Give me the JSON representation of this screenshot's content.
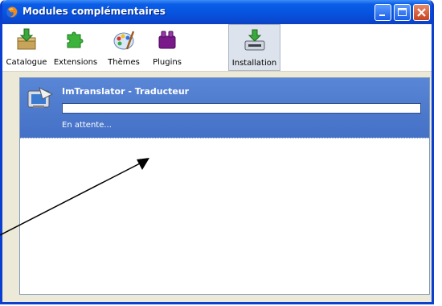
{
  "window": {
    "title": "Modules complémentaires"
  },
  "toolbar": {
    "items": [
      {
        "label": "Catalogue",
        "icon": "catalogue-icon"
      },
      {
        "label": "Extensions",
        "icon": "puzzle-icon"
      },
      {
        "label": "Thèmes",
        "icon": "palette-icon"
      },
      {
        "label": "Plugins",
        "icon": "plugin-icon"
      },
      {
        "label": "Installation",
        "icon": "install-icon"
      }
    ],
    "active": "Installation"
  },
  "install_item": {
    "name": "ImTranslator - Traducteur",
    "status": "En attente...",
    "progress": 0
  },
  "colors": {
    "titlebar": "#0a5ce6",
    "selected_item": "#4a77cc",
    "window_bg": "#ece9d8"
  }
}
